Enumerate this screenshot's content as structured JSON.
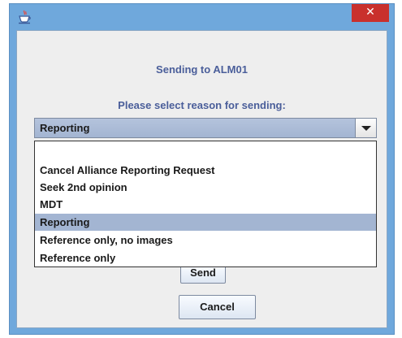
{
  "window": {
    "icon": "java-cup-icon",
    "close_glyph": "✕"
  },
  "dialog": {
    "title": "Sending to ALM01",
    "prompt": "Please select reason for sending:"
  },
  "reason_select": {
    "selected": "Reporting",
    "options": [
      "",
      "Cancel Alliance Reporting Request",
      "Seek 2nd opinion",
      "MDT",
      "Reporting",
      "Reference only, no images",
      "Reference only"
    ],
    "highlighted_index": 4
  },
  "buttons": {
    "send": "Send",
    "cancel": "Cancel"
  },
  "colors": {
    "title_text": "#4a5e9a",
    "window_frame": "#6fa8dc",
    "close_button": "#c9302c",
    "selection": "#a3b5d2"
  }
}
